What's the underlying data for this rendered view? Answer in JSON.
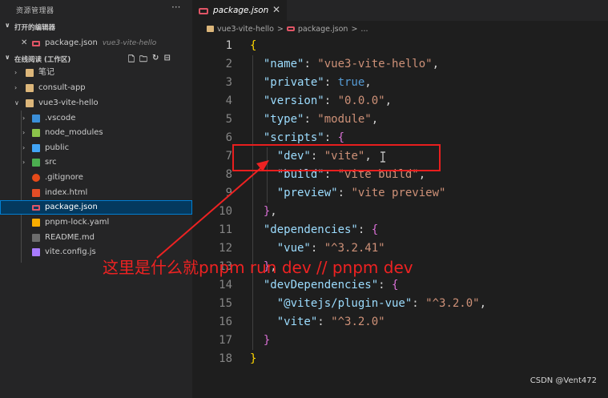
{
  "sidebar": {
    "title": "资源管理器",
    "more": "···",
    "open_editors_label": "打开的编辑器",
    "open_editor": {
      "close": "✕",
      "name": "package.json",
      "path": "vue3-vite-hello"
    },
    "workspace_label": "在线阅读 (工作区)",
    "tree": [
      {
        "label": "笔记"
      },
      {
        "label": "consult-app"
      },
      {
        "label": "vue3-vite-hello"
      },
      {
        "label": ".vscode"
      },
      {
        "label": "node_modules"
      },
      {
        "label": "public"
      },
      {
        "label": "src"
      },
      {
        "label": ".gitignore"
      },
      {
        "label": "index.html"
      },
      {
        "label": "package.json"
      },
      {
        "label": "pnpm-lock.yaml"
      },
      {
        "label": "README.md"
      },
      {
        "label": "vite.config.js"
      }
    ]
  },
  "editor": {
    "tab": {
      "name": "package.json",
      "close": "✕"
    },
    "breadcrumb": {
      "folder": "vue3-vite-hello",
      "sep1": ">",
      "file": "package.json",
      "sep2": ">",
      "tail": "..."
    },
    "line_numbers": [
      "1",
      "2",
      "3",
      "4",
      "5",
      "6",
      "7",
      "8",
      "9",
      "10",
      "11",
      "12",
      "13",
      "14",
      "15",
      "16",
      "17",
      "18"
    ],
    "code": {
      "l1": "{",
      "name_key": "\"name\"",
      "name_val": "\"vue3-vite-hello\"",
      "private_key": "\"private\"",
      "private_val": "true",
      "version_key": "\"version\"",
      "version_val": "\"0.0.0\"",
      "type_key": "\"type\"",
      "type_val": "\"module\"",
      "scripts_key": "\"scripts\"",
      "dev_key": "\"dev\"",
      "dev_val": "\"vite\"",
      "build_key": "\"build\"",
      "build_val": "\"vite build\"",
      "preview_key": "\"preview\"",
      "preview_val": "\"vite preview\"",
      "deps_key": "\"dependencies\"",
      "vue_key": "\"vue\"",
      "vue_val": "\"^3.2.41\"",
      "devdeps_key": "\"devDependencies\"",
      "plugin_key": "\"@vitejs/plugin-vue\"",
      "plugin_val": "\"^3.2.0\"",
      "vite_key": "\"vite\"",
      "vite_val": "\"^3.2.0\"",
      "colon": ": ",
      "comma": ",",
      "open_brace": "{",
      "close_brace": "}"
    }
  },
  "annotation": {
    "text": "这里是什么就pnpm run dev  // pnpm dev",
    "color": "#ee2222"
  },
  "watermark": "CSDN @Vent472",
  "colors": {
    "accent_selection": "#04395e",
    "json_icon": "#e05566",
    "key": "#9cdcfe",
    "string": "#ce9178"
  }
}
